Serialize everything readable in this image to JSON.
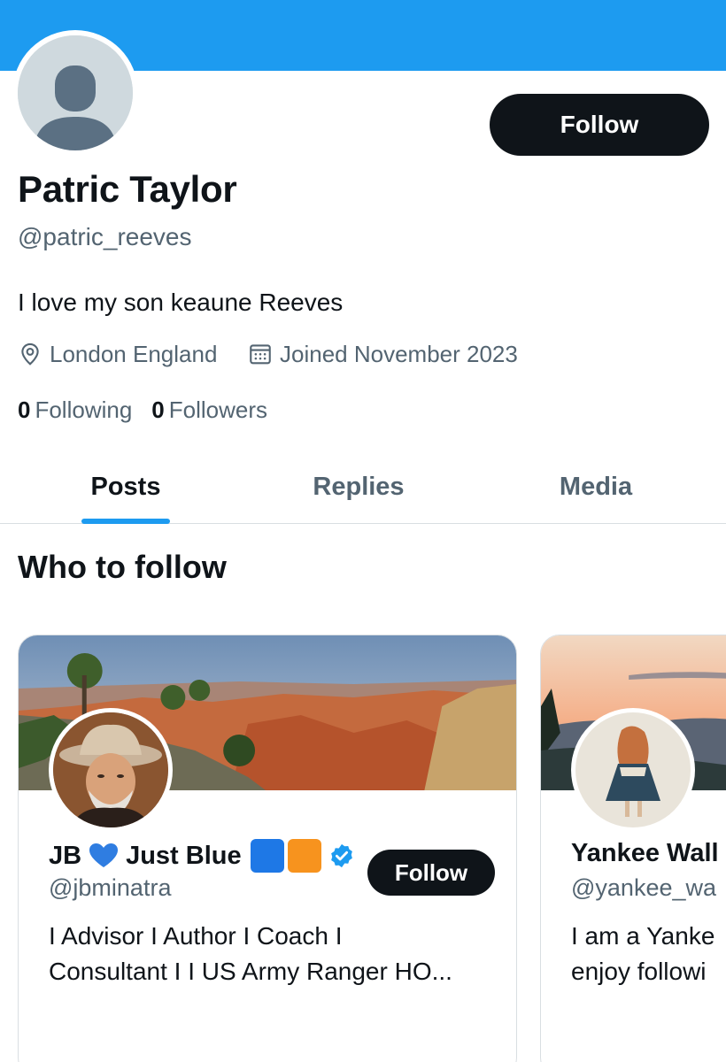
{
  "profile": {
    "name": "Patric Taylor",
    "handle": "@patric_reeves",
    "bio": "I love my son keaune Reeves",
    "location": "London England",
    "joined": "Joined November 2023",
    "following_count": "0",
    "following_label": "Following",
    "followers_count": "0",
    "followers_label": "Followers",
    "follow_label": "Follow"
  },
  "colors": {
    "banner": "#1d9bf0",
    "accent": "#1d9bf0",
    "button_bg": "#0f1419",
    "secondary_text": "#536471"
  },
  "tabs": [
    {
      "label": "Posts",
      "active": true
    },
    {
      "label": "Replies",
      "active": false
    },
    {
      "label": "Media",
      "active": false
    }
  ],
  "who_to_follow": {
    "title": "Who to follow",
    "cards": [
      {
        "name_prefix": "JB",
        "name_suffix": "Just Blue",
        "handle": "@jbminatra",
        "bio_line1": "I Advisor I Author I Coach I",
        "bio_line2": "Consultant I I US Army Ranger HO...",
        "follow_label": "Follow",
        "verified": true,
        "icons": [
          "blue-heart-emoji",
          "blue-square-emoji",
          "orange-square-emoji",
          "verified-badge-icon"
        ]
      },
      {
        "name": "Yankee Wall",
        "handle": "@yankee_wa",
        "bio_line1": "I am a Yanke",
        "bio_line2": "enjoy followi"
      }
    ]
  },
  "icons": {
    "location": "location-pin-icon",
    "joined": "calendar-icon"
  }
}
